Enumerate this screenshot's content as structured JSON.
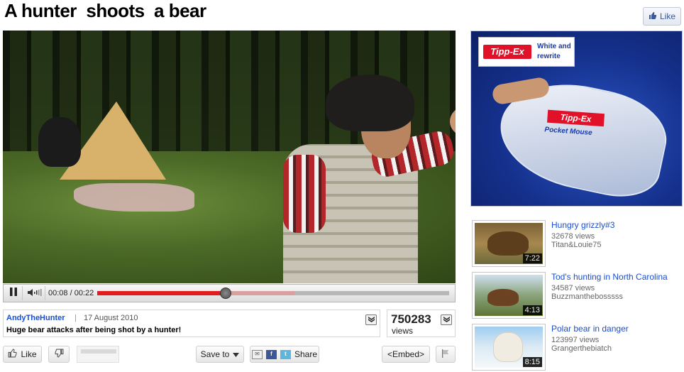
{
  "page": {
    "title": "A hunter  shoots  a bear",
    "fb_like_label": "Like"
  },
  "player": {
    "time_display": "00:08 / 00:22",
    "current_seconds": 8,
    "total_seconds": 22,
    "loaded_fraction": 0.56
  },
  "info": {
    "uploader": "AndyTheHunter",
    "separator": "|",
    "date": "17 August 2010",
    "description": "Huge bear attacks after being shot by a hunter!",
    "view_count": "750283",
    "views_label": "views"
  },
  "actions": {
    "like_label": "Like",
    "save_label": "Save to",
    "share_label": "Share",
    "embed_label": "<Embed>"
  },
  "ad": {
    "brand": "Tipp-Ex",
    "tagline_line1": "White and",
    "tagline_line2": "rewrite",
    "device_label": "Tipp-Ex",
    "device_sub": "Pocket Mouse"
  },
  "related": [
    {
      "title": "Hungry grizzly#3",
      "views": "32678 views",
      "author": "Titan&Louie75",
      "duration": "7:22"
    },
    {
      "title": "Tod's hunting in North Carolina",
      "views": "34587 views",
      "author": "Buzzmanthebosssss",
      "duration": "4:13"
    },
    {
      "title": "Polar bear in danger",
      "views": "123997 views",
      "author": "Grangerthebiatch",
      "duration": "8:15"
    }
  ],
  "colors": {
    "link_blue": "#1a4ed0",
    "progress_red": "#e31d1d",
    "brand_red": "#e2112a"
  }
}
